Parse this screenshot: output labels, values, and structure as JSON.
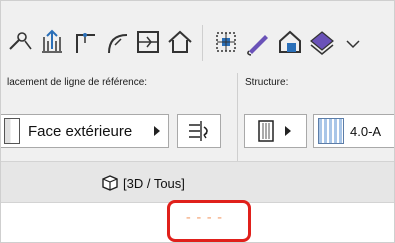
{
  "toolbar": {
    "tools": [
      {
        "icon": "magic-wand-icon"
      },
      {
        "icon": "reference-line-icon"
      },
      {
        "icon": "orthogonal-line-icon"
      },
      {
        "icon": "arc-line-icon"
      },
      {
        "icon": "rectangle-insert-icon"
      },
      {
        "icon": "house-roof-icon"
      },
      {
        "icon": "selection-grid-icon"
      },
      {
        "icon": "pencil-eyedropper-icon"
      },
      {
        "icon": "favorites-icon"
      },
      {
        "icon": "layer-arrow-icon"
      }
    ]
  },
  "placement": {
    "section_label": "lacement de ligne de référence:",
    "face_value": "Face extérieure"
  },
  "structure": {
    "section_label": "Structure:",
    "composite_value": "4.0-A"
  },
  "tab": {
    "label": "[3D / Tous]"
  },
  "view": {
    "dash_text": "----"
  },
  "colors": {
    "highlight": "#e0201b",
    "dash": "#f3a070",
    "composite_fill": "#a9c6e8"
  }
}
